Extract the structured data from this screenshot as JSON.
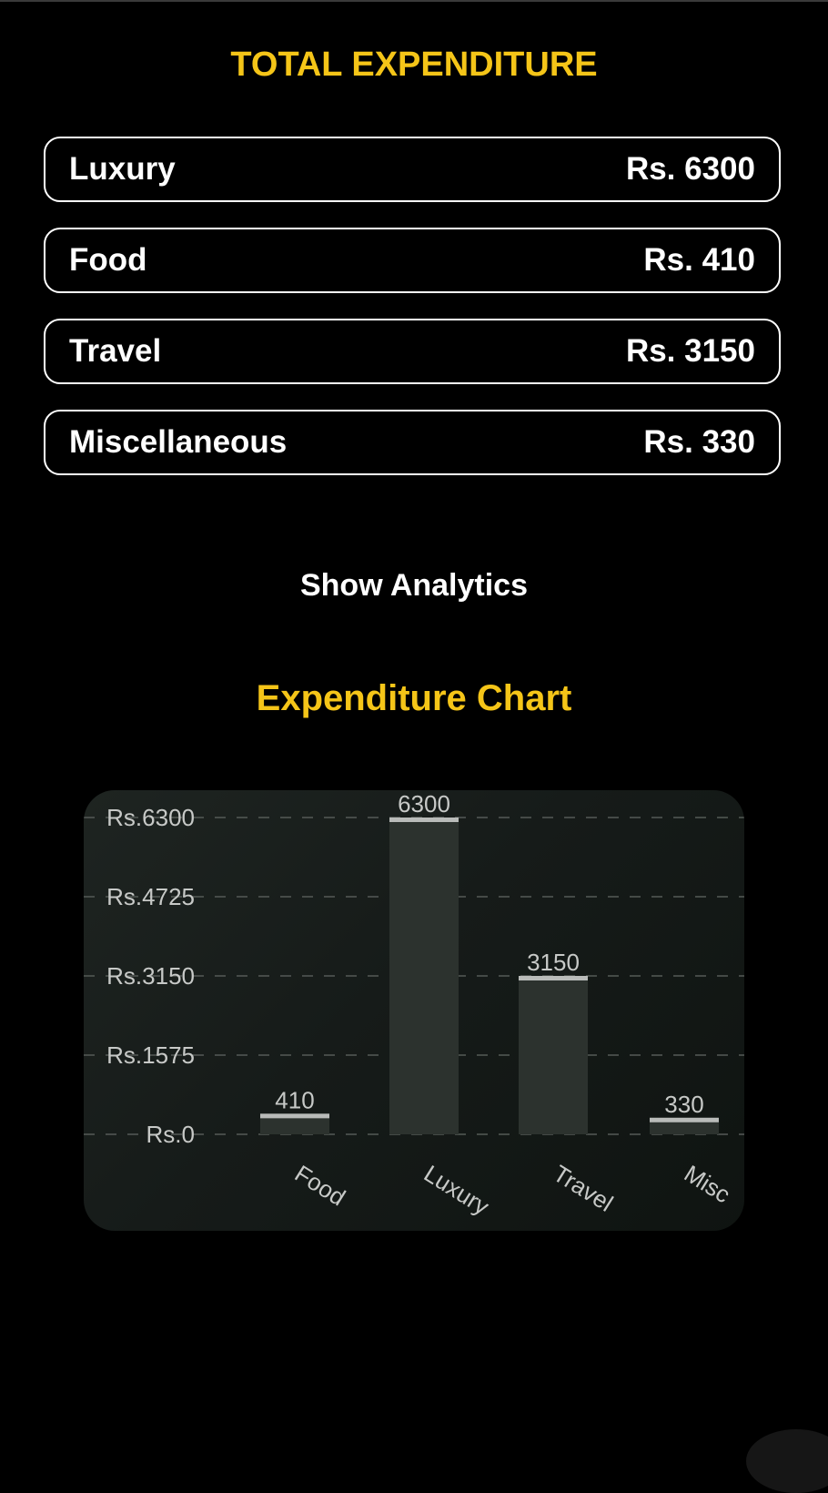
{
  "header": {
    "title": "TOTAL EXPENDITURE"
  },
  "expenses": [
    {
      "label": "Luxury",
      "amount": "Rs. 6300"
    },
    {
      "label": "Food",
      "amount": "Rs. 410"
    },
    {
      "label": "Travel",
      "amount": "Rs. 3150"
    },
    {
      "label": "Miscellaneous",
      "amount": "Rs. 330"
    }
  ],
  "analytics_button": {
    "label": "Show Analytics"
  },
  "chart_section": {
    "title": "Expenditure Chart"
  },
  "colors": {
    "accent": "#f5c518",
    "bar": "#2c322e",
    "bar_cap": "#b9bbb9",
    "grid": "#555a57",
    "text_muted": "#c7c9c7"
  },
  "chart_data": {
    "type": "bar",
    "categories": [
      "Food",
      "Luxury",
      "Travel",
      "Misc"
    ],
    "values": [
      410,
      6300,
      3150,
      330
    ],
    "value_labels": [
      "410",
      "6300",
      "3150",
      "330"
    ],
    "y_ticks": [
      "Rs.0",
      "Rs.1575",
      "Rs.3150",
      "Rs.4725",
      "Rs.6300"
    ],
    "y_tick_values": [
      0,
      1575,
      3150,
      4725,
      6300
    ],
    "ylim": [
      0,
      6300
    ],
    "grid": true
  }
}
